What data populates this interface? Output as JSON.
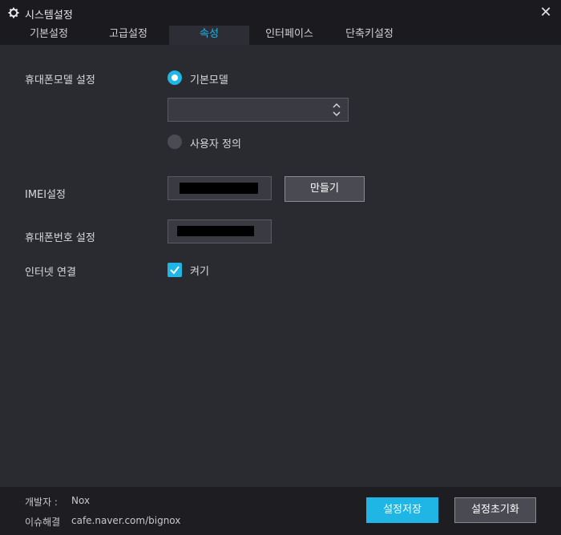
{
  "window": {
    "title": "시스템설정",
    "icon": "gear-icon",
    "close_icon": "close-icon"
  },
  "tabs": [
    {
      "label": "기본설정",
      "active": false
    },
    {
      "label": "고급설정",
      "active": false
    },
    {
      "label": "속성",
      "active": true
    },
    {
      "label": "인터페이스",
      "active": false
    },
    {
      "label": "단축키설정",
      "active": false
    }
  ],
  "phone_model": {
    "label": "휴대폰모델 설정",
    "option_default": "기본모델",
    "option_custom": "사용자 정의",
    "selected": "기본모델",
    "select_value": ""
  },
  "imei": {
    "label": "IMEI설정",
    "value_redacted": true,
    "generate_button": "만들기"
  },
  "phone_number": {
    "label": "휴대폰번호 설정",
    "value_redacted": true
  },
  "internet": {
    "label": "인터넷 연결",
    "checkbox_label": "켜기",
    "checked": true
  },
  "footer": {
    "developer_label": "개발자 :",
    "developer_value": "Nox",
    "issue_label": "이슈해결",
    "issue_value": "cafe.naver.com/bignox",
    "save_button": "설정저장",
    "reset_button": "설정초기화"
  },
  "colors": {
    "accent": "#1fb6e6",
    "background": "#2a2b31",
    "titlebar": "#1b1b1f"
  }
}
